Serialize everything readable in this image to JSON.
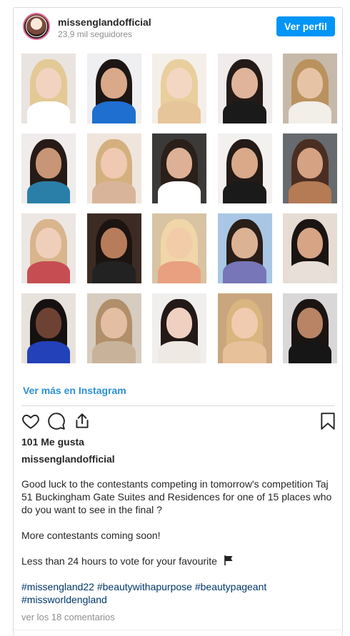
{
  "header": {
    "username": "missenglandofficial",
    "followers": "23,9 mil seguidores",
    "profile_button": "Ver perfil"
  },
  "grid": {
    "photos": [
      {
        "bg": "#e9e4df",
        "hair": "#e2c995",
        "skin": "#f1d3c0",
        "cloth": "#ffffff"
      },
      {
        "bg": "#efeef0",
        "hair": "#1c1614",
        "skin": "#d9a98a",
        "cloth": "#1f6fd0"
      },
      {
        "bg": "#f4efe9",
        "hair": "#e8cf9d",
        "skin": "#f3d7c3",
        "cloth": "#e6c59a"
      },
      {
        "bg": "#efeceb",
        "hair": "#241a17",
        "skin": "#e0b49a",
        "cloth": "#1a1a1a"
      },
      {
        "bg": "#c7b9aa",
        "hair": "#b9925e",
        "skin": "#e7c3a6",
        "cloth": "#f2eee8"
      },
      {
        "bg": "#efeceb",
        "hair": "#261b16",
        "skin": "#c99577",
        "cloth": "#2a7fa8"
      },
      {
        "bg": "#efe5dc",
        "hair": "#d4b07e",
        "skin": "#efc9b1",
        "cloth": "#d8b59a"
      },
      {
        "bg": "#3b3a38",
        "hair": "#2b1f19",
        "skin": "#deb196",
        "cloth": "#ffffff"
      },
      {
        "bg": "#f3f1ef",
        "hair": "#241a17",
        "skin": "#d9a98a",
        "cloth": "#1a1a1a"
      },
      {
        "bg": "#676a6e",
        "hair": "#4a2e22",
        "skin": "#d5a283",
        "cloth": "#b57b54"
      },
      {
        "bg": "#ece7e3",
        "hair": "#d8b58c",
        "skin": "#efcfba",
        "cloth": "#c64e52"
      },
      {
        "bg": "#3c2b24",
        "hair": "#1c1411",
        "skin": "#b77d5b",
        "cloth": "#222222"
      },
      {
        "bg": "#d8c3a3",
        "hair": "#f0d6a8",
        "skin": "#f2cba9",
        "cloth": "#e8a080"
      },
      {
        "bg": "#a9c7e4",
        "hair": "#2a1e18",
        "skin": "#dcb295",
        "cloth": "#7776b8"
      },
      {
        "bg": "#e6dcd4",
        "hair": "#1a1412",
        "skin": "#d7a486",
        "cloth": "#e8e0d8"
      },
      {
        "bg": "#e8e2dd",
        "hair": "#151111",
        "skin": "#6e4233",
        "cloth": "#2341b8"
      },
      {
        "bg": "#d6ccc0",
        "hair": "#b08f6a",
        "skin": "#e4bea3",
        "cloth": "#c8b39a"
      },
      {
        "bg": "#f1efed",
        "hair": "#231917",
        "skin": "#f0d0c0",
        "cloth": "#efe9e4"
      },
      {
        "bg": "#c9a580",
        "hair": "#d9b57f",
        "skin": "#f1cbb0",
        "cloth": "#e7c19a"
      },
      {
        "bg": "#d9d7d7",
        "hair": "#1b1413",
        "skin": "#b98466",
        "cloth": "#161616"
      }
    ]
  },
  "links": {
    "more": "Ver más en Instagram"
  },
  "actions": {
    "like_icon": "heart-icon",
    "comment_icon": "comment-icon",
    "share_icon": "share-icon",
    "save_icon": "bookmark-icon"
  },
  "post": {
    "likes": "101 Me gusta",
    "caption_user": "missenglandofficial",
    "caption_p1": "Good luck to the contestants competing in tomorrow's competition Taj 51 Buckingham Gate Suites and Residences for one of 15 places who do you want to see in the final ?",
    "caption_p2": "More contestants coming soon!",
    "caption_p3": "Less than 24 hours to vote for your favourite",
    "flag_icon": "black-flag-icon",
    "hashtags": "#missengland22 #beautywithapurpose #beautypageant #missworldengland",
    "comments": "ver los 18 comentarios"
  }
}
